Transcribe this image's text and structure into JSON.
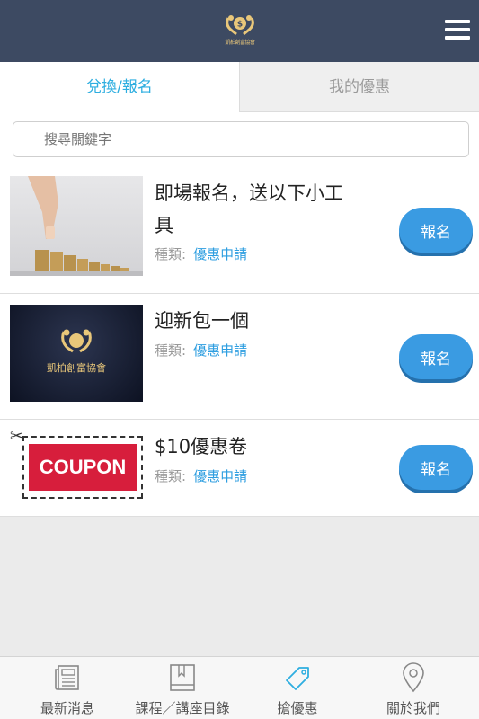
{
  "header": {
    "logo_text": "凱柏創富協會"
  },
  "tabs": [
    {
      "label": "兌換/報名",
      "active": true
    },
    {
      "label": "我的優惠",
      "active": false
    }
  ],
  "search": {
    "placeholder": "搜尋關鍵字"
  },
  "items": [
    {
      "title": "即場報名，送以下小工具",
      "category_label": "種類:",
      "category_value": "優惠申請",
      "button_label": "報名",
      "image": "coins-stack"
    },
    {
      "title": "迎新包一個",
      "category_label": "種類:",
      "category_value": "優惠申請",
      "button_label": "報名",
      "image": "association-logo",
      "image_text": "凱柏創富協會"
    },
    {
      "title": "$10優惠卷",
      "category_label": "種類:",
      "category_value": "優惠申請",
      "button_label": "報名",
      "image": "coupon",
      "image_text": "COUPON"
    }
  ],
  "tabbar": [
    {
      "label": "最新消息",
      "icon": "newspaper-icon"
    },
    {
      "label": "課程／講座目錄",
      "icon": "book-icon"
    },
    {
      "label": "搶優惠",
      "icon": "tag-icon",
      "active": true
    },
    {
      "label": "關於我們",
      "icon": "location-pin-icon"
    }
  ],
  "colors": {
    "header_bg": "#3d4a62",
    "accent": "#2eaee0",
    "button": "#3a9be2"
  }
}
